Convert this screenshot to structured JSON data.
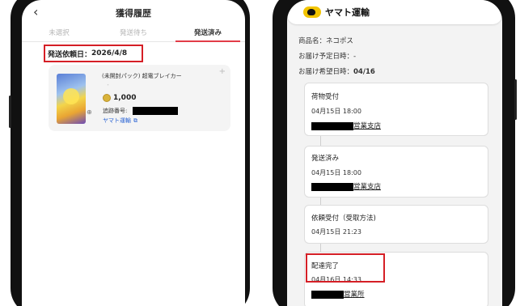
{
  "left": {
    "header": {
      "back_glyph": "‹",
      "title": "獲得履歴"
    },
    "tabs": [
      {
        "label": "未選択",
        "active": false
      },
      {
        "label": "発送待ち",
        "active": false
      },
      {
        "label": "発送済み",
        "active": true
      }
    ],
    "request_date": {
      "label": "発送依頼日：",
      "value": "2026/4/8"
    },
    "item": {
      "name": "(未開封パック) 超電ブレイカー",
      "dot": "・",
      "plus": "+",
      "price": "1,000",
      "tracking_label": "追跡番号:",
      "carrier_link": "ヤマト運輸",
      "zoom_icon": "⊕"
    }
  },
  "right": {
    "brand": "ヤマト運輸",
    "info": [
      {
        "label": "商品名：",
        "value": "ネコポス",
        "bold": false
      },
      {
        "label": "お届け予定日時：",
        "value": "-",
        "bold": false
      },
      {
        "label": "お届け希望日時：",
        "value": "04/16",
        "bold": true
      }
    ],
    "steps": [
      {
        "title": "荷物受付",
        "time": "04月15日 18:00",
        "office_suffix": "営業支店"
      },
      {
        "title": "発送済み",
        "time": "04月15日 18:00",
        "office_suffix": "営業支店"
      },
      {
        "title": "依頼受付（受取方法)",
        "time": "04月15日 21:23",
        "office_suffix": ""
      },
      {
        "title": "配達完了",
        "time": "04月16日 14:33",
        "office_suffix": "営業所"
      }
    ]
  },
  "colors": {
    "highlight": "#d51f26",
    "tab_underline": "#e23c48",
    "link": "#2a63d4",
    "coin": "#d9b33a",
    "yamato_yellow": "#f2c400"
  }
}
